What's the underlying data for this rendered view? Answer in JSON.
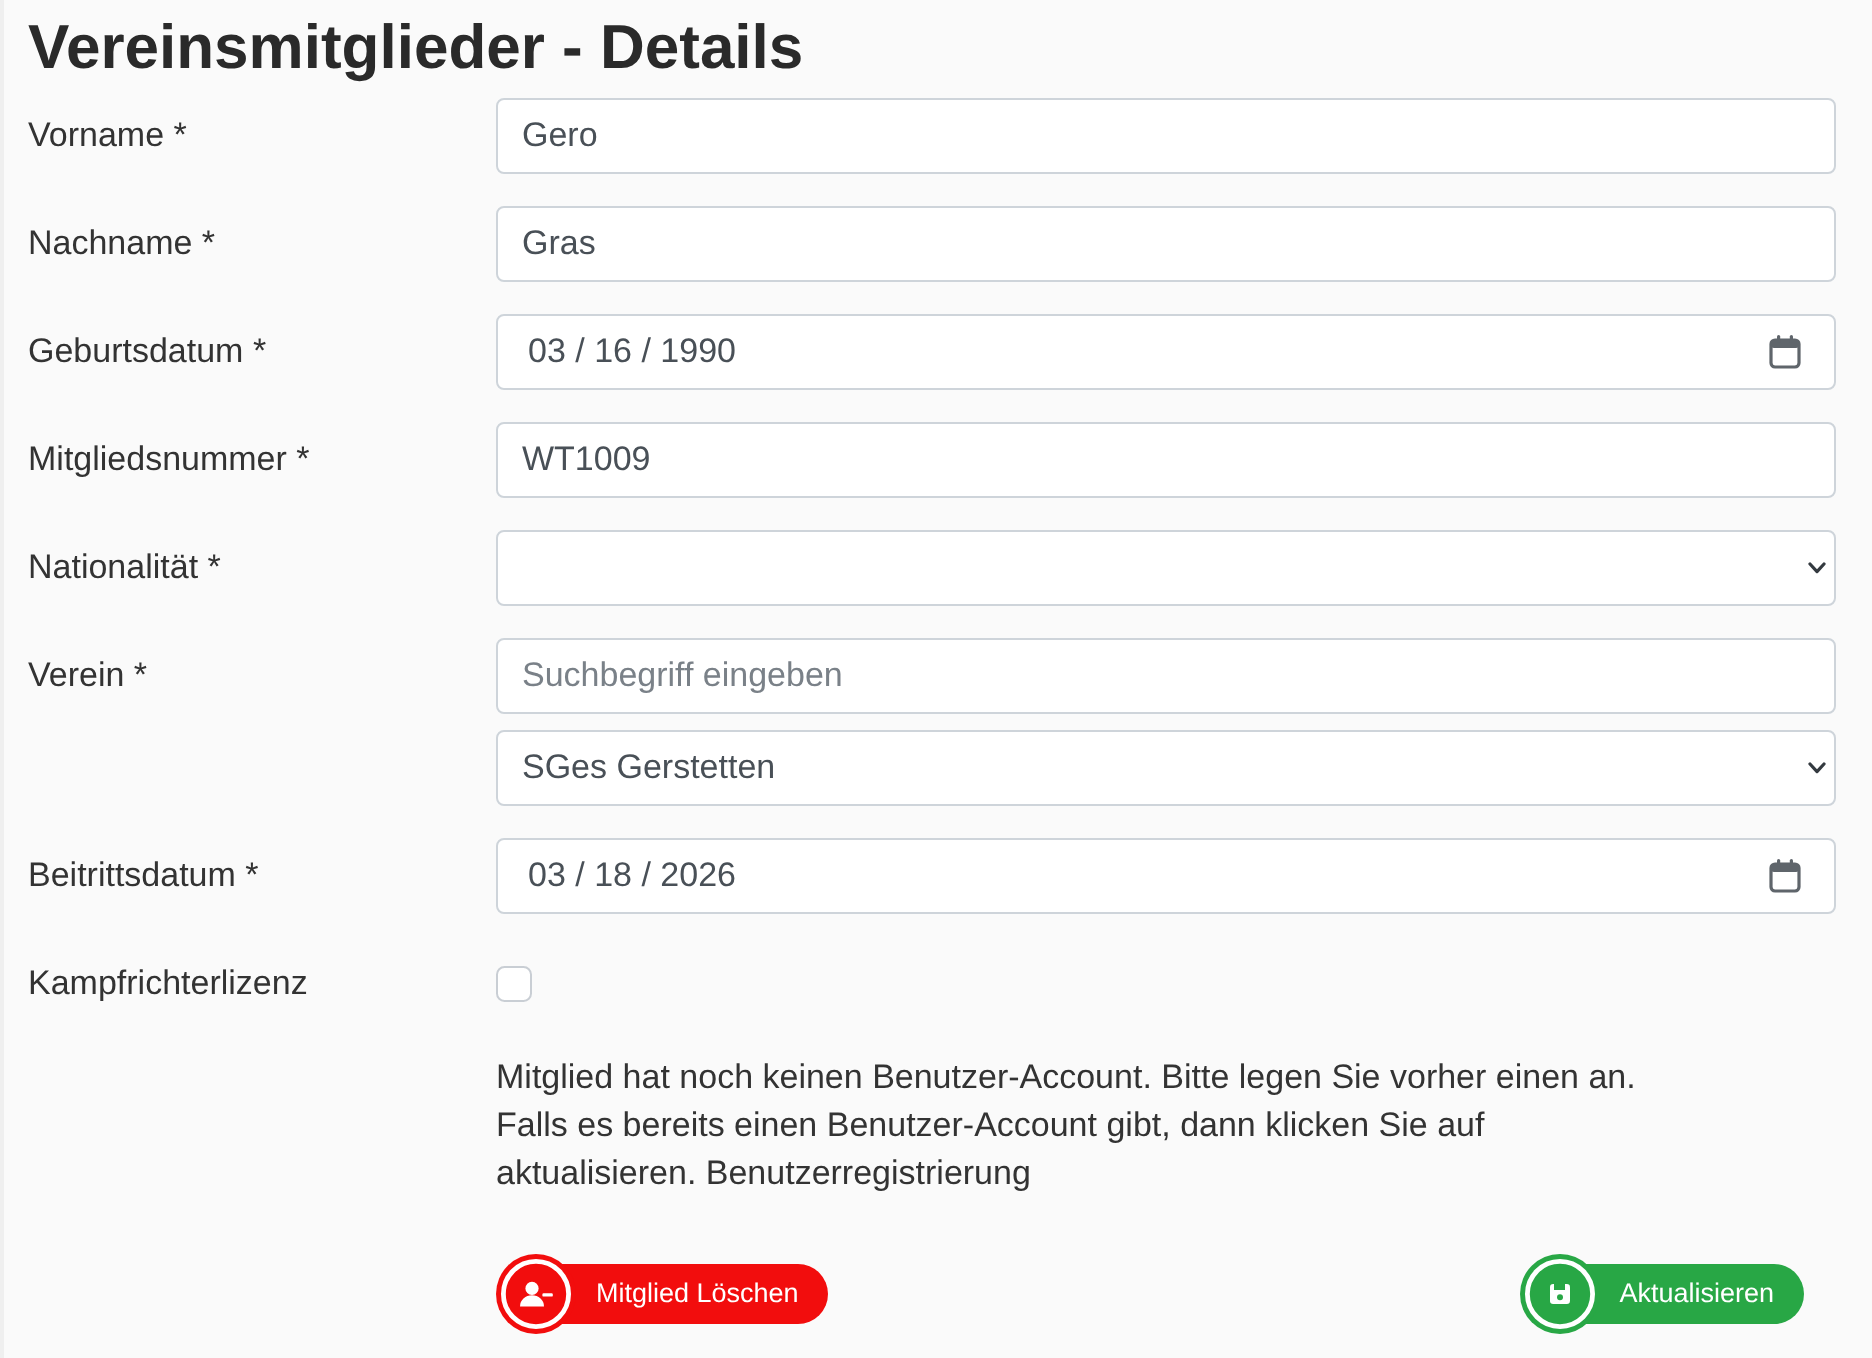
{
  "title": "Vereinsmitglieder - Details",
  "fields": [
    {
      "label": "Vorname *",
      "controls": [
        {
          "kind": "text",
          "value": "Gero"
        }
      ]
    },
    {
      "label": "Nachname *",
      "controls": [
        {
          "kind": "text",
          "value": "Gras"
        }
      ]
    },
    {
      "label": "Geburtsdatum *",
      "controls": [
        {
          "kind": "date",
          "value": "03 / 16 / 1990"
        }
      ]
    },
    {
      "label": "Mitgliedsnummer *",
      "controls": [
        {
          "kind": "text",
          "value": "WT1009"
        }
      ]
    },
    {
      "label": "Nationalität *",
      "controls": [
        {
          "kind": "select"
        }
      ]
    },
    {
      "label": "Verein *",
      "controls": [
        {
          "kind": "search",
          "placeholder": "Suchbegriff eingeben"
        },
        {
          "kind": "select",
          "value": "SGes Gerstetten"
        }
      ]
    },
    {
      "label": "Beitrittsdatum *",
      "controls": [
        {
          "kind": "date",
          "value": "03 / 18 / 2026"
        }
      ]
    },
    {
      "label": "Kampfrichterlizenz",
      "controls": [
        {
          "kind": "checkbox",
          "checked": false
        }
      ]
    }
  ],
  "notice": {
    "lines": [
      "Mitglied hat noch keinen Benutzer-Account. Bitte legen Sie vorher einen an.",
      "Falls es bereits einen Benutzer-Account gibt, dann klicken Sie auf",
      "aktualisieren. Benutzerregistrierung"
    ]
  },
  "buttons": [
    {
      "kind": "delete",
      "label": "Mitglied Löschen"
    },
    {
      "kind": "update",
      "label": "Aktualisieren"
    }
  ]
}
